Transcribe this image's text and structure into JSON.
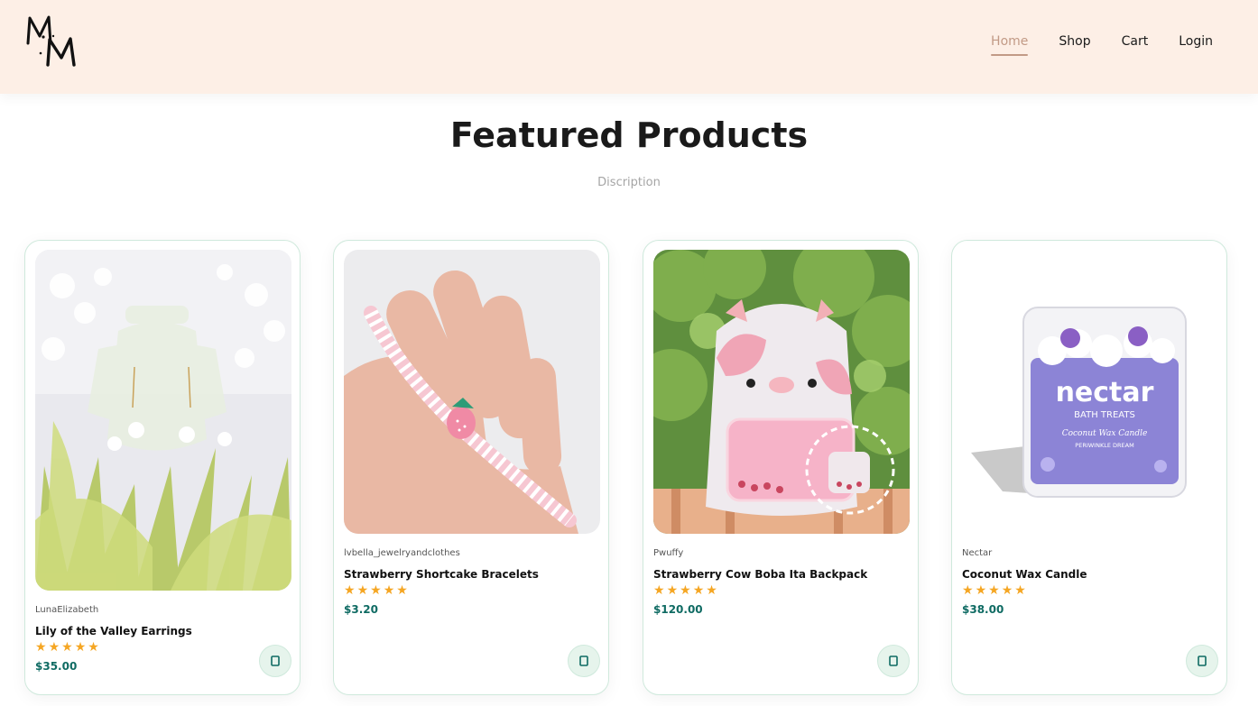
{
  "nav": {
    "items": [
      {
        "label": "Home",
        "active": true
      },
      {
        "label": "Shop",
        "active": false
      },
      {
        "label": "Cart",
        "active": false
      },
      {
        "label": "Login",
        "active": false
      }
    ]
  },
  "section": {
    "title": "Featured Products",
    "subtitle": "Discription"
  },
  "products": [
    {
      "brand": "LunaElizabeth",
      "name": "Lily of the Valley Earrings",
      "rating": 5,
      "price": "$35.00"
    },
    {
      "brand": "lvbella_jewelryandclothes",
      "name": "Strawberry Shortcake Bracelets",
      "rating": 5,
      "price": "$3.20"
    },
    {
      "brand": "Pwuffy",
      "name": "Strawberry Cow Boba Ita Backpack",
      "rating": 5,
      "price": "$120.00"
    },
    {
      "brand": "Nectar",
      "name": "Coconut Wax Candle",
      "rating": 5,
      "price": "$38.00"
    }
  ],
  "product_images": {
    "candle": {
      "brand_text": "nectar",
      "sub_text": "BATH TREATS",
      "line1": "Coconut Wax Candle",
      "line2": "PERIWINKLE DREAM"
    }
  },
  "colors": {
    "accent": "#c29a86",
    "header_bg": "#fdefe6",
    "price": "#0f6b63",
    "star": "#f5a623",
    "cart_bg": "#e6f4ec"
  },
  "icons": {
    "cart_button": "phone-icon",
    "rating": "star-icon"
  }
}
